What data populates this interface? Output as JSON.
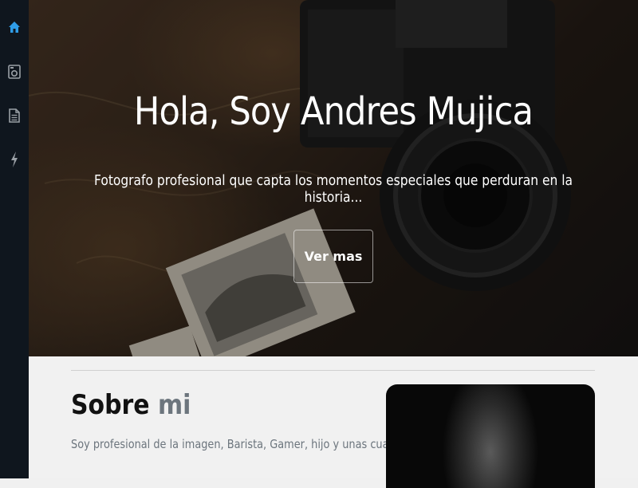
{
  "sidebar": {
    "items": [
      {
        "icon": "home-icon",
        "active": true
      },
      {
        "icon": "camera-icon",
        "active": false
      },
      {
        "icon": "document-icon",
        "active": false
      },
      {
        "icon": "lightning-icon",
        "active": false
      }
    ],
    "active_color": "#2f9de8",
    "icon_color": "#9aa0a6"
  },
  "hero": {
    "title": "Hola, Soy Andres Mujica",
    "subtitle": "Fotografo profesional que capta los momentos especiales que perduran en la historia...",
    "button_label": "Ver mas"
  },
  "about": {
    "title_main": "Sobre",
    "title_accent": "mi",
    "text": "Soy profesional de la imagen, Barista, Gamer, hijo y unas cuantas cosas más."
  }
}
